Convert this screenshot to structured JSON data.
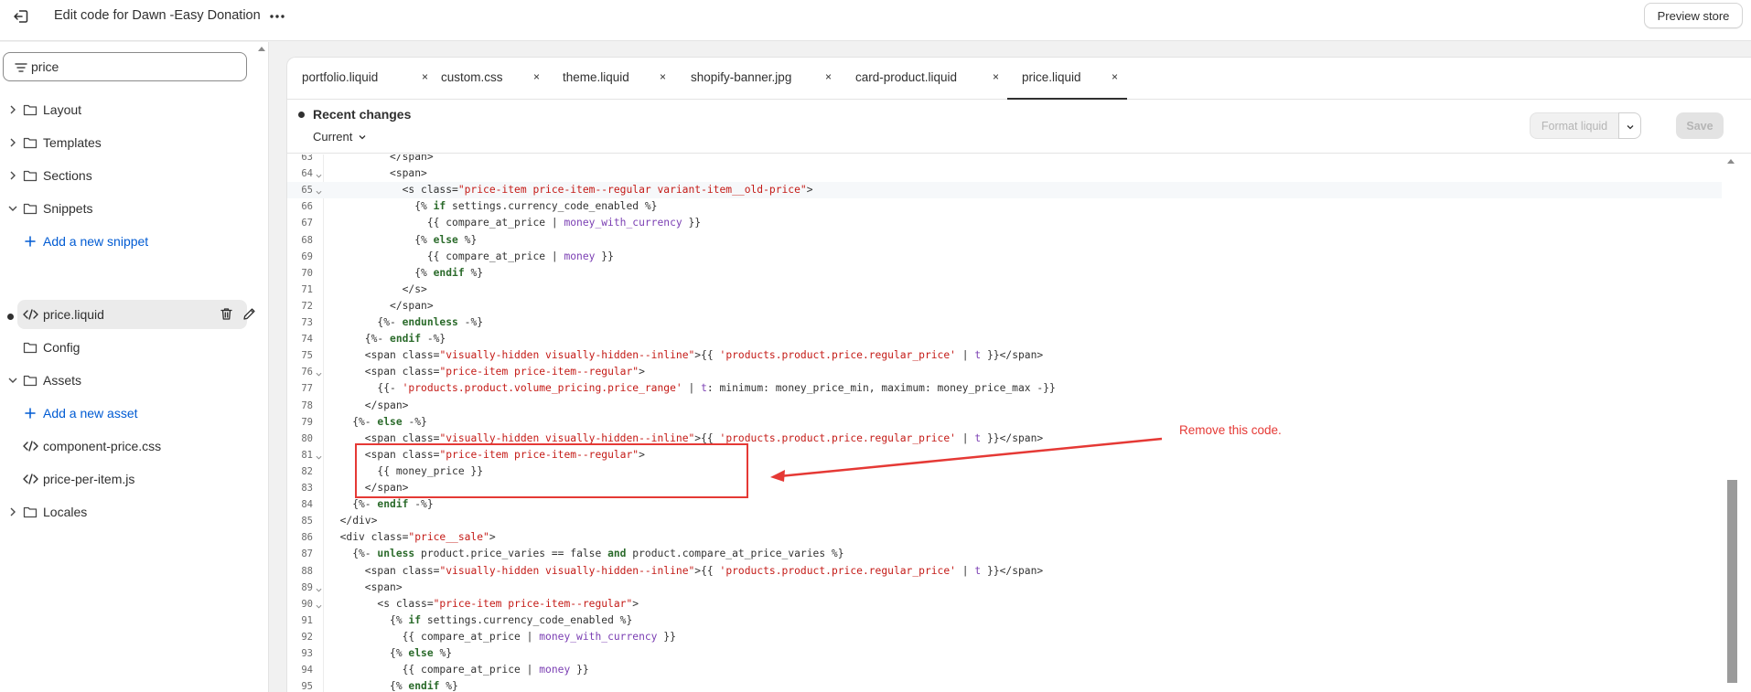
{
  "topbar": {
    "title": "Edit code for Dawn -Easy Donation",
    "preview_label": "Preview store"
  },
  "sidebar": {
    "search_value": "price",
    "items": [
      {
        "label": "Layout",
        "type": "folder"
      },
      {
        "label": "Templates",
        "type": "folder"
      },
      {
        "label": "Sections",
        "type": "folder"
      },
      {
        "label": "Snippets",
        "type": "folder",
        "expanded": true
      },
      {
        "label": "Add a new snippet",
        "type": "add"
      },
      {
        "label": "price.liquid",
        "type": "file",
        "selected": true
      },
      {
        "label": "Config",
        "type": "folder-noexpand"
      },
      {
        "label": "Assets",
        "type": "folder",
        "expanded": true
      },
      {
        "label": "Add a new asset",
        "type": "add"
      },
      {
        "label": "component-price.css",
        "type": "file"
      },
      {
        "label": "price-per-item.js",
        "type": "file"
      },
      {
        "label": "Locales",
        "type": "folder"
      }
    ]
  },
  "tabs": [
    {
      "label": "portfolio.liquid",
      "close": "×"
    },
    {
      "label": "custom.css",
      "close": "×"
    },
    {
      "label": "theme.liquid",
      "close": "×"
    },
    {
      "label": "shopify-banner.jpg",
      "close": "×"
    },
    {
      "label": "card-product.liquid",
      "close": "×"
    },
    {
      "label": "price.liquid",
      "close": "×",
      "active": true
    }
  ],
  "changes": {
    "title": "Recent changes",
    "version": "Current",
    "format_label": "Format liquid",
    "save_label": "Save"
  },
  "code": {
    "line_numbers": [
      "63",
      "64",
      "65",
      "66",
      "67",
      "68",
      "69",
      "70",
      "71",
      "72",
      "73",
      "74",
      "75",
      "76",
      "77",
      "78",
      "79",
      "80",
      "81",
      "82",
      "83",
      "84",
      "85",
      "86",
      "87",
      "88",
      "89",
      "90",
      "91",
      "92",
      "93",
      "94",
      "95"
    ],
    "lines": [
      "          </span>",
      "          <span>",
      "            <s class=\"price-item price-item--regular variant-item__old-price\">",
      "              {% if settings.currency_code_enabled %}",
      "                {{ compare_at_price | money_with_currency }}",
      "              {% else %}",
      "                {{ compare_at_price | money }}",
      "              {% endif %}",
      "            </s>",
      "          </span>",
      "        {%- endunless -%}",
      "      {%- endif -%}",
      "      <span class=\"visually-hidden visually-hidden--inline\">{{ 'products.product.price.regular_price' | t }}</span>",
      "      <span class=\"price-item price-item--regular\">",
      "        {{- 'products.product.volume_pricing.price_range' | t: minimum: money_price_min, maximum: money_price_max -}}",
      "      </span>",
      "    {%- else -%}",
      "      <span class=\"visually-hidden visually-hidden--inline\">{{ 'products.product.price.regular_price' | t }}</span>",
      "      <span class=\"price-item price-item--regular\">",
      "        {{ money_price }}",
      "      </span>",
      "    {%- endif -%}",
      "  </div>",
      "  <div class=\"price__sale\">",
      "    {%- unless product.price_varies == false and product.compare_at_price_varies %}",
      "      <span class=\"visually-hidden visually-hidden--inline\">{{ 'products.product.price.regular_price' | t }}</span>",
      "      <span>",
      "        <s class=\"price-item price-item--regular\">",
      "          {% if settings.currency_code_enabled %}",
      "            {{ compare_at_price | money_with_currency }}",
      "          {% else %}",
      "            {{ compare_at_price | money }}",
      "          {% endif %}"
    ]
  },
  "annotation": {
    "text": "Remove this code."
  }
}
